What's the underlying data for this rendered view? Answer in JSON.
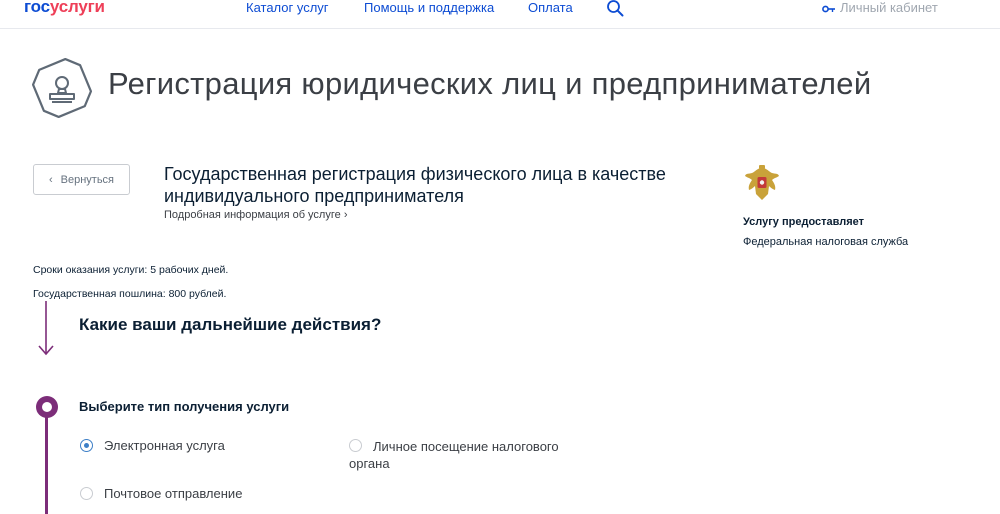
{
  "header": {
    "logo_part1": "гос",
    "logo_part2": "услуги",
    "nav": [
      "Каталог услуг",
      "Помощь и поддержка",
      "Оплата"
    ],
    "cabinet": "Личный кабинет"
  },
  "page": {
    "title": "Регистрация юридических лиц и предпринимателей",
    "back_label": "Вернуться",
    "service_title": "Государственная регистрация физического лица в качестве индивидуального предпринимателя",
    "service_link": "Подробная информация об услуге",
    "provider_label": "Услугу предоставляет",
    "provider_name": "Федеральная налоговая служба",
    "term": "Сроки оказания услуги: 5 рабочих дней.",
    "fee": "Государственная пошлина: 800 рублей.",
    "question": "Какие ваши дальнейшие действия?",
    "step_title": "Выберите тип получения услуги",
    "options": [
      {
        "label": "Электронная услуга",
        "selected": true
      },
      {
        "label": "Личное посещение налогового органа",
        "selected": false
      },
      {
        "label": "Почтовое отправление",
        "selected": false
      }
    ]
  },
  "colors": {
    "brand_blue": "#0d4cd3",
    "brand_red": "#ee3f58",
    "step_accent": "#7c2d79",
    "radio_selected": "#3d7fc7"
  },
  "icons": [
    "search-icon",
    "key-icon",
    "stamp-icon",
    "chevron-left-icon",
    "chevron-right-icon",
    "emblem-icon",
    "arrow-down-icon"
  ]
}
